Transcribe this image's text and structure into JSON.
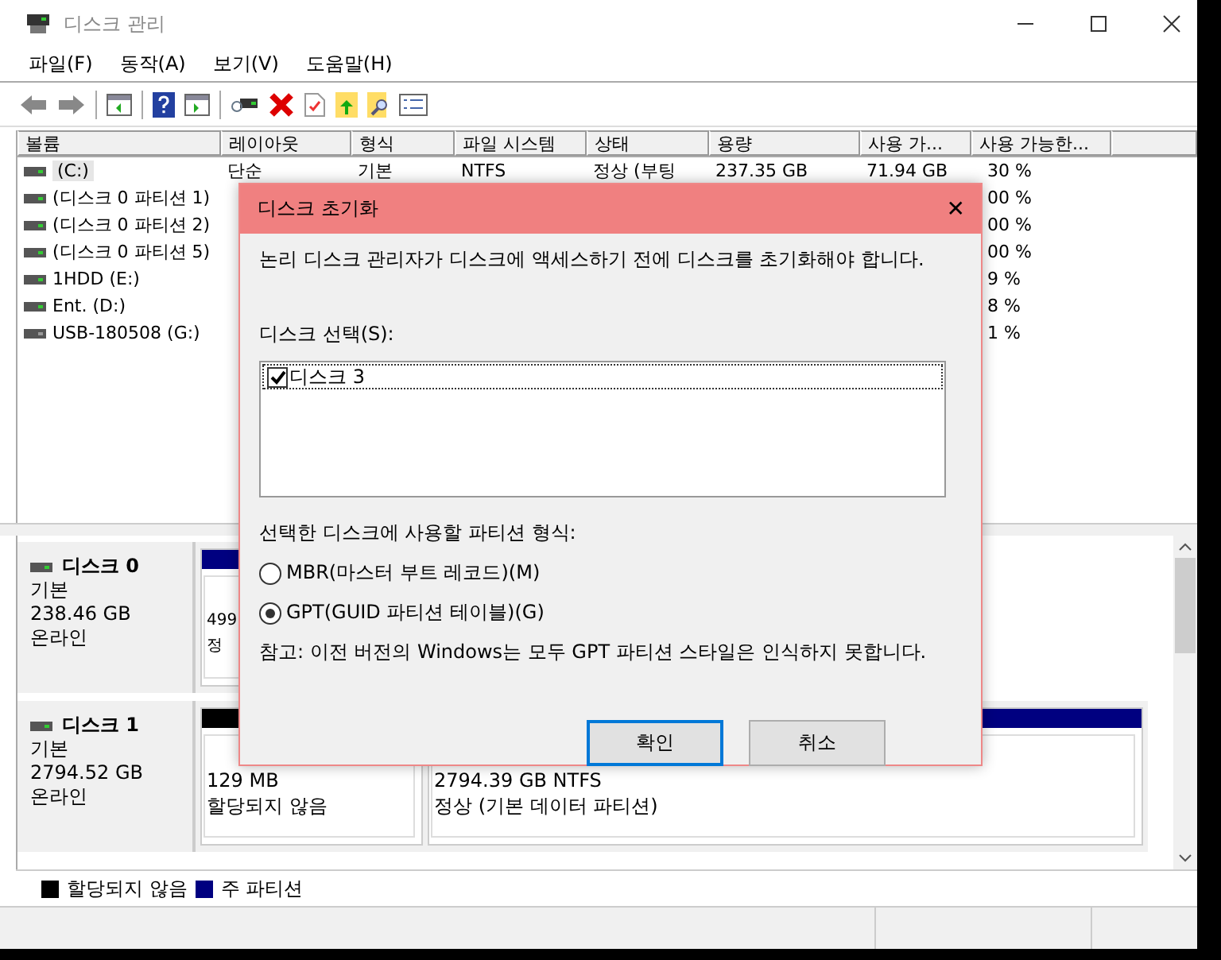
{
  "window": {
    "title": "디스크 관리"
  },
  "menu": [
    "파일(F)",
    "동작(A)",
    "보기(V)",
    "도움말(H)"
  ],
  "volume_table": {
    "columns": [
      "볼륨",
      "레이아웃",
      "형식",
      "파일 시스템",
      "상태",
      "용량",
      "사용 가...",
      "사용 가능한..."
    ],
    "rows": [
      {
        "volume": "(C:)",
        "layout": "단순",
        "type": "기본",
        "file_system": "NTFS",
        "status": "정상 (부팅",
        "capacity": "237.35 GB",
        "free": "71.94 GB",
        "free_pct": "30 %",
        "selected": true
      },
      {
        "volume": "(디스크 0 파티션 1)",
        "free_pct": "00 %",
        "selected": false
      },
      {
        "volume": "(디스크 0 파티션 2)",
        "free_pct": "00 %",
        "selected": false
      },
      {
        "volume": "(디스크 0 파티션 5)",
        "free_pct": "00 %",
        "selected": false
      },
      {
        "volume": "1HDD (E:)",
        "free_pct": "9 %",
        "selected": false
      },
      {
        "volume": "Ent. (D:)",
        "free_pct": "8 %",
        "selected": false
      },
      {
        "volume": "USB-180508 (G:)",
        "free_pct": "1 %",
        "selected": false
      }
    ]
  },
  "disks": [
    {
      "name": "디스크 0",
      "type": "기본",
      "size": "238.46 GB",
      "status": "온라인",
      "partitions": [
        {
          "kind": "primary",
          "lines": [
            "499",
            "정"
          ]
        }
      ]
    },
    {
      "name": "디스크 1",
      "type": "기본",
      "size": "2794.52 GB",
      "status": "온라인",
      "partitions": [
        {
          "kind": "unallocated",
          "lines": [
            "129 MB",
            "할당되지 않음"
          ]
        },
        {
          "kind": "primary",
          "lines": [
            "2794.39 GB NTFS",
            "정상 (기본 데이터 파티션)"
          ]
        }
      ]
    }
  ],
  "legend": [
    {
      "label": "할당되지 않음",
      "color": "#000000"
    },
    {
      "label": "주 파티션",
      "color": "#000080"
    }
  ],
  "dialog": {
    "title": "디스크 초기화",
    "close": "✕",
    "message": "논리 디스크 관리자가 디스크에 액세스하기 전에 디스크를 초기화해야 합니다.",
    "disk_list_label": "디스크 선택(S):",
    "disk_list": [
      {
        "label": "디스크 3",
        "checked": true
      }
    ],
    "partition_style_label": "선택한 디스크에 사용할 파티션 형식:",
    "partition_styles": [
      {
        "label": "MBR(마스터 부트 레코드)(M)",
        "selected": false
      },
      {
        "label": "GPT(GUID 파티션 테이블)(G)",
        "selected": true
      }
    ],
    "note": "참고: 이전 버전의 Windows는 모두 GPT 파티션 스타일은 인식하지 못합니다.",
    "buttons": [
      {
        "label": "확인",
        "default": true
      },
      {
        "label": "취소",
        "default": false
      }
    ]
  }
}
